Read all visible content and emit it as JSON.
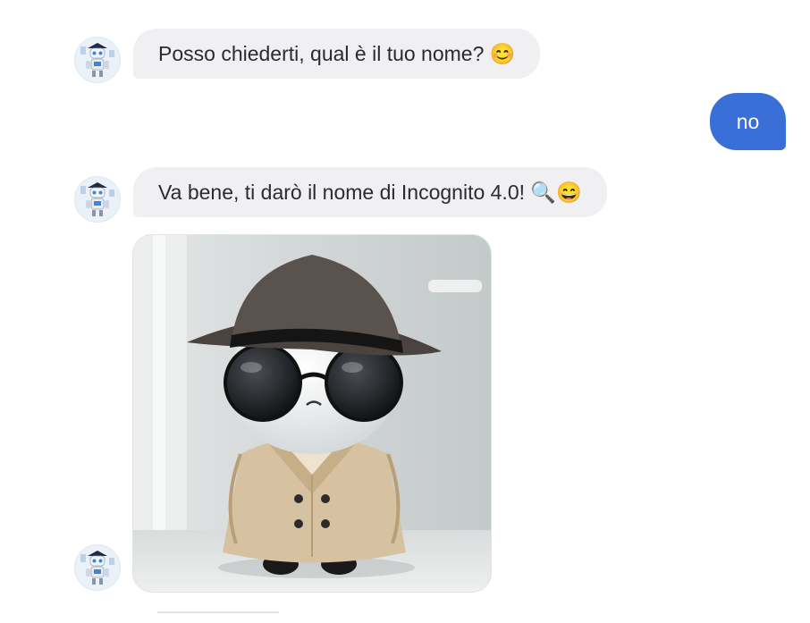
{
  "messages": [
    {
      "sender": "bot",
      "text": "Posso chiederti, qual è il tuo nome? 😊"
    },
    {
      "sender": "user",
      "text": "no"
    },
    {
      "sender": "bot",
      "text": "Va bene, ti darò il nome di Incognito 4.0! 🔍😄"
    },
    {
      "sender": "bot",
      "type": "image",
      "image_description": "incognito-detective-character"
    }
  ],
  "icons": {
    "avatar": "robot-avatar-icon",
    "image": "detective-character-image"
  },
  "colors": {
    "bot_bubble_bg": "#f0f0f2",
    "user_bubble_bg": "#3a6fd8",
    "text_dark": "#2b2b2e",
    "text_light": "#ffffff"
  }
}
